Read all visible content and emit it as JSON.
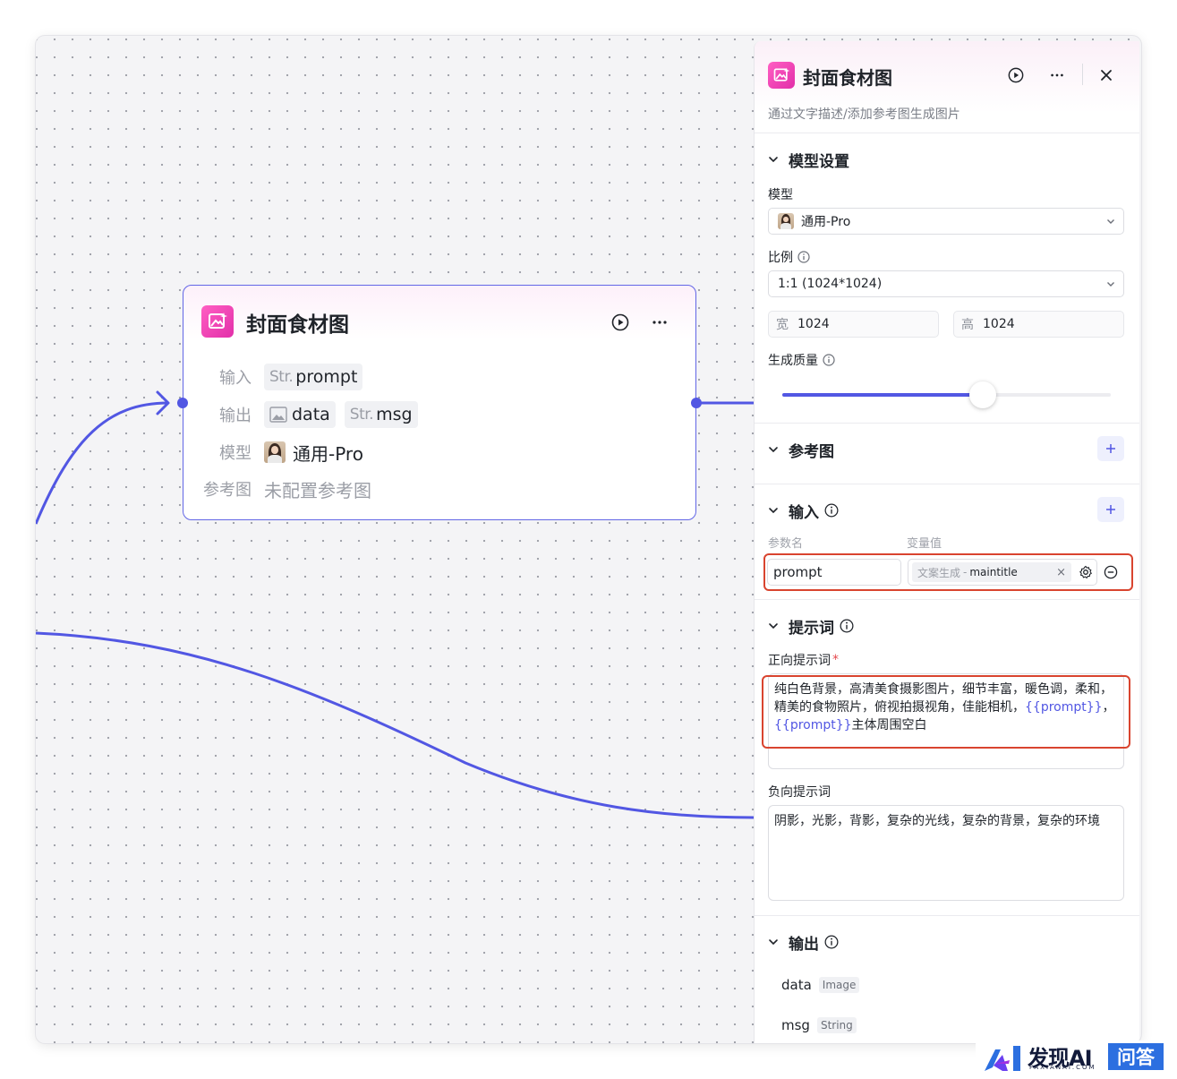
{
  "node": {
    "title": "封面食材图",
    "rows": {
      "input_label": "输入",
      "input_type": "Str.",
      "input_value": "prompt",
      "output_label": "输出",
      "output_1_value": "data",
      "output_2_type": "Str.",
      "output_2_value": "msg",
      "model_label": "模型",
      "model_value": "通用-Pro",
      "ref_label": "参考图",
      "ref_value": "未配置参考图"
    }
  },
  "panel": {
    "title": "封面食材图",
    "description": "通过文字描述/添加参考图生成图片",
    "model_settings": {
      "title": "模型设置",
      "model_label": "模型",
      "model_value": "通用-Pro",
      "ratio_label": "比例",
      "ratio_value": "1:1 (1024*1024)",
      "width_label": "宽",
      "width_value": "1024",
      "height_label": "高",
      "height_value": "1024",
      "quality_label": "生成质量",
      "quality_level": 0.61
    },
    "reference": {
      "title": "参考图"
    },
    "input": {
      "title": "输入",
      "col_param": "参数名",
      "col_value": "变量值",
      "param_name": "prompt",
      "var_source": "文案生成",
      "var_separator": "-",
      "var_name": "maintitle",
      "remove_tag": "×"
    },
    "prompt": {
      "title": "提示词",
      "positive_label": "正向提示词",
      "required_mark": "*",
      "positive_text_1": "纯白色背景，高清美食摄影图片，细节丰富，暖色调，柔和，精美的食物照片，俯视拍摄视角，佳能相机，",
      "positive_var_1": "{{prompt}}",
      "positive_text_2": "，",
      "positive_var_2": "{{prompt}}",
      "positive_text_3": "主体周围空白",
      "negative_label": "负向提示词",
      "negative_text": "阴影，光影，背影，复杂的光线，复杂的背景，复杂的环境"
    },
    "output": {
      "title": "输出",
      "items": [
        {
          "name": "data",
          "type": "Image"
        },
        {
          "name": "msg",
          "type": "String"
        }
      ]
    }
  },
  "watermark": {
    "brand": "发现AI",
    "domain": "FAXIANAI.COM",
    "badge": "问答"
  },
  "colors": {
    "accent": "#5257e3",
    "icon_pink": "#e22fa9",
    "highlight_red": "#d9442f",
    "watermark_blue": "#2c6fe0"
  },
  "icons": [
    "image-generate-icon",
    "play-circle-icon",
    "more-icon",
    "close-icon",
    "chevron-down-icon",
    "info-icon",
    "plus-icon",
    "settings-icon",
    "remove-circle-icon",
    "image-type-icon",
    "avatar-image"
  ]
}
